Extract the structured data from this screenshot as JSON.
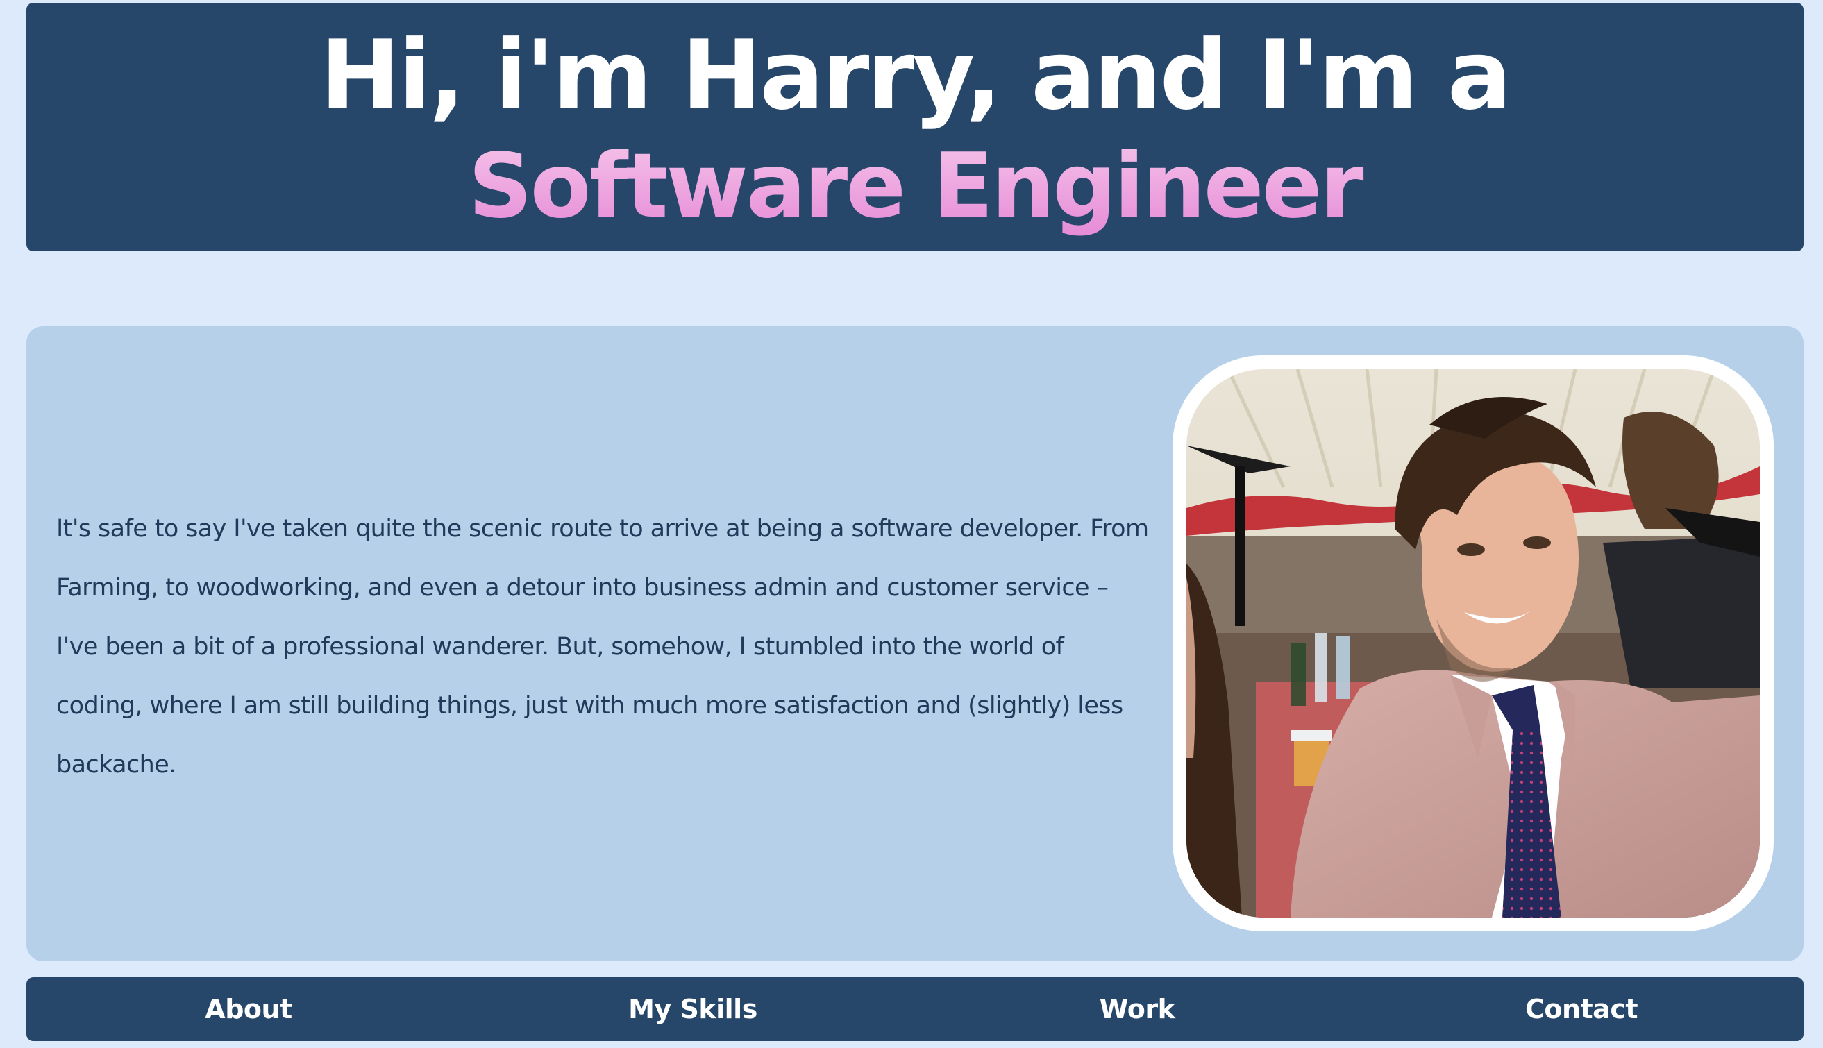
{
  "hero": {
    "line1": "Hi, i'm Harry, and I'm a",
    "line2": "Software Engineer"
  },
  "about": {
    "text": "It's safe to say I've taken quite the scenic route to arrive at being a software developer. From Farming, to woodworking, and even a detour into business admin and customer service – I've been a bit of a professional wanderer. But, somehow, I stumbled into the world of coding, where I am still building things, just with much more satisfaction and (slightly) less backache."
  },
  "nav": {
    "items": [
      {
        "label": "About"
      },
      {
        "label": "My Skills"
      },
      {
        "label": "Work"
      },
      {
        "label": "Contact"
      }
    ]
  },
  "colors": {
    "page_background": "#ddeafb",
    "primary_dark": "#264769",
    "panel_background": "#b6d0ea",
    "accent_pink": "#e58ad6",
    "text_dark": "#213a5a"
  }
}
